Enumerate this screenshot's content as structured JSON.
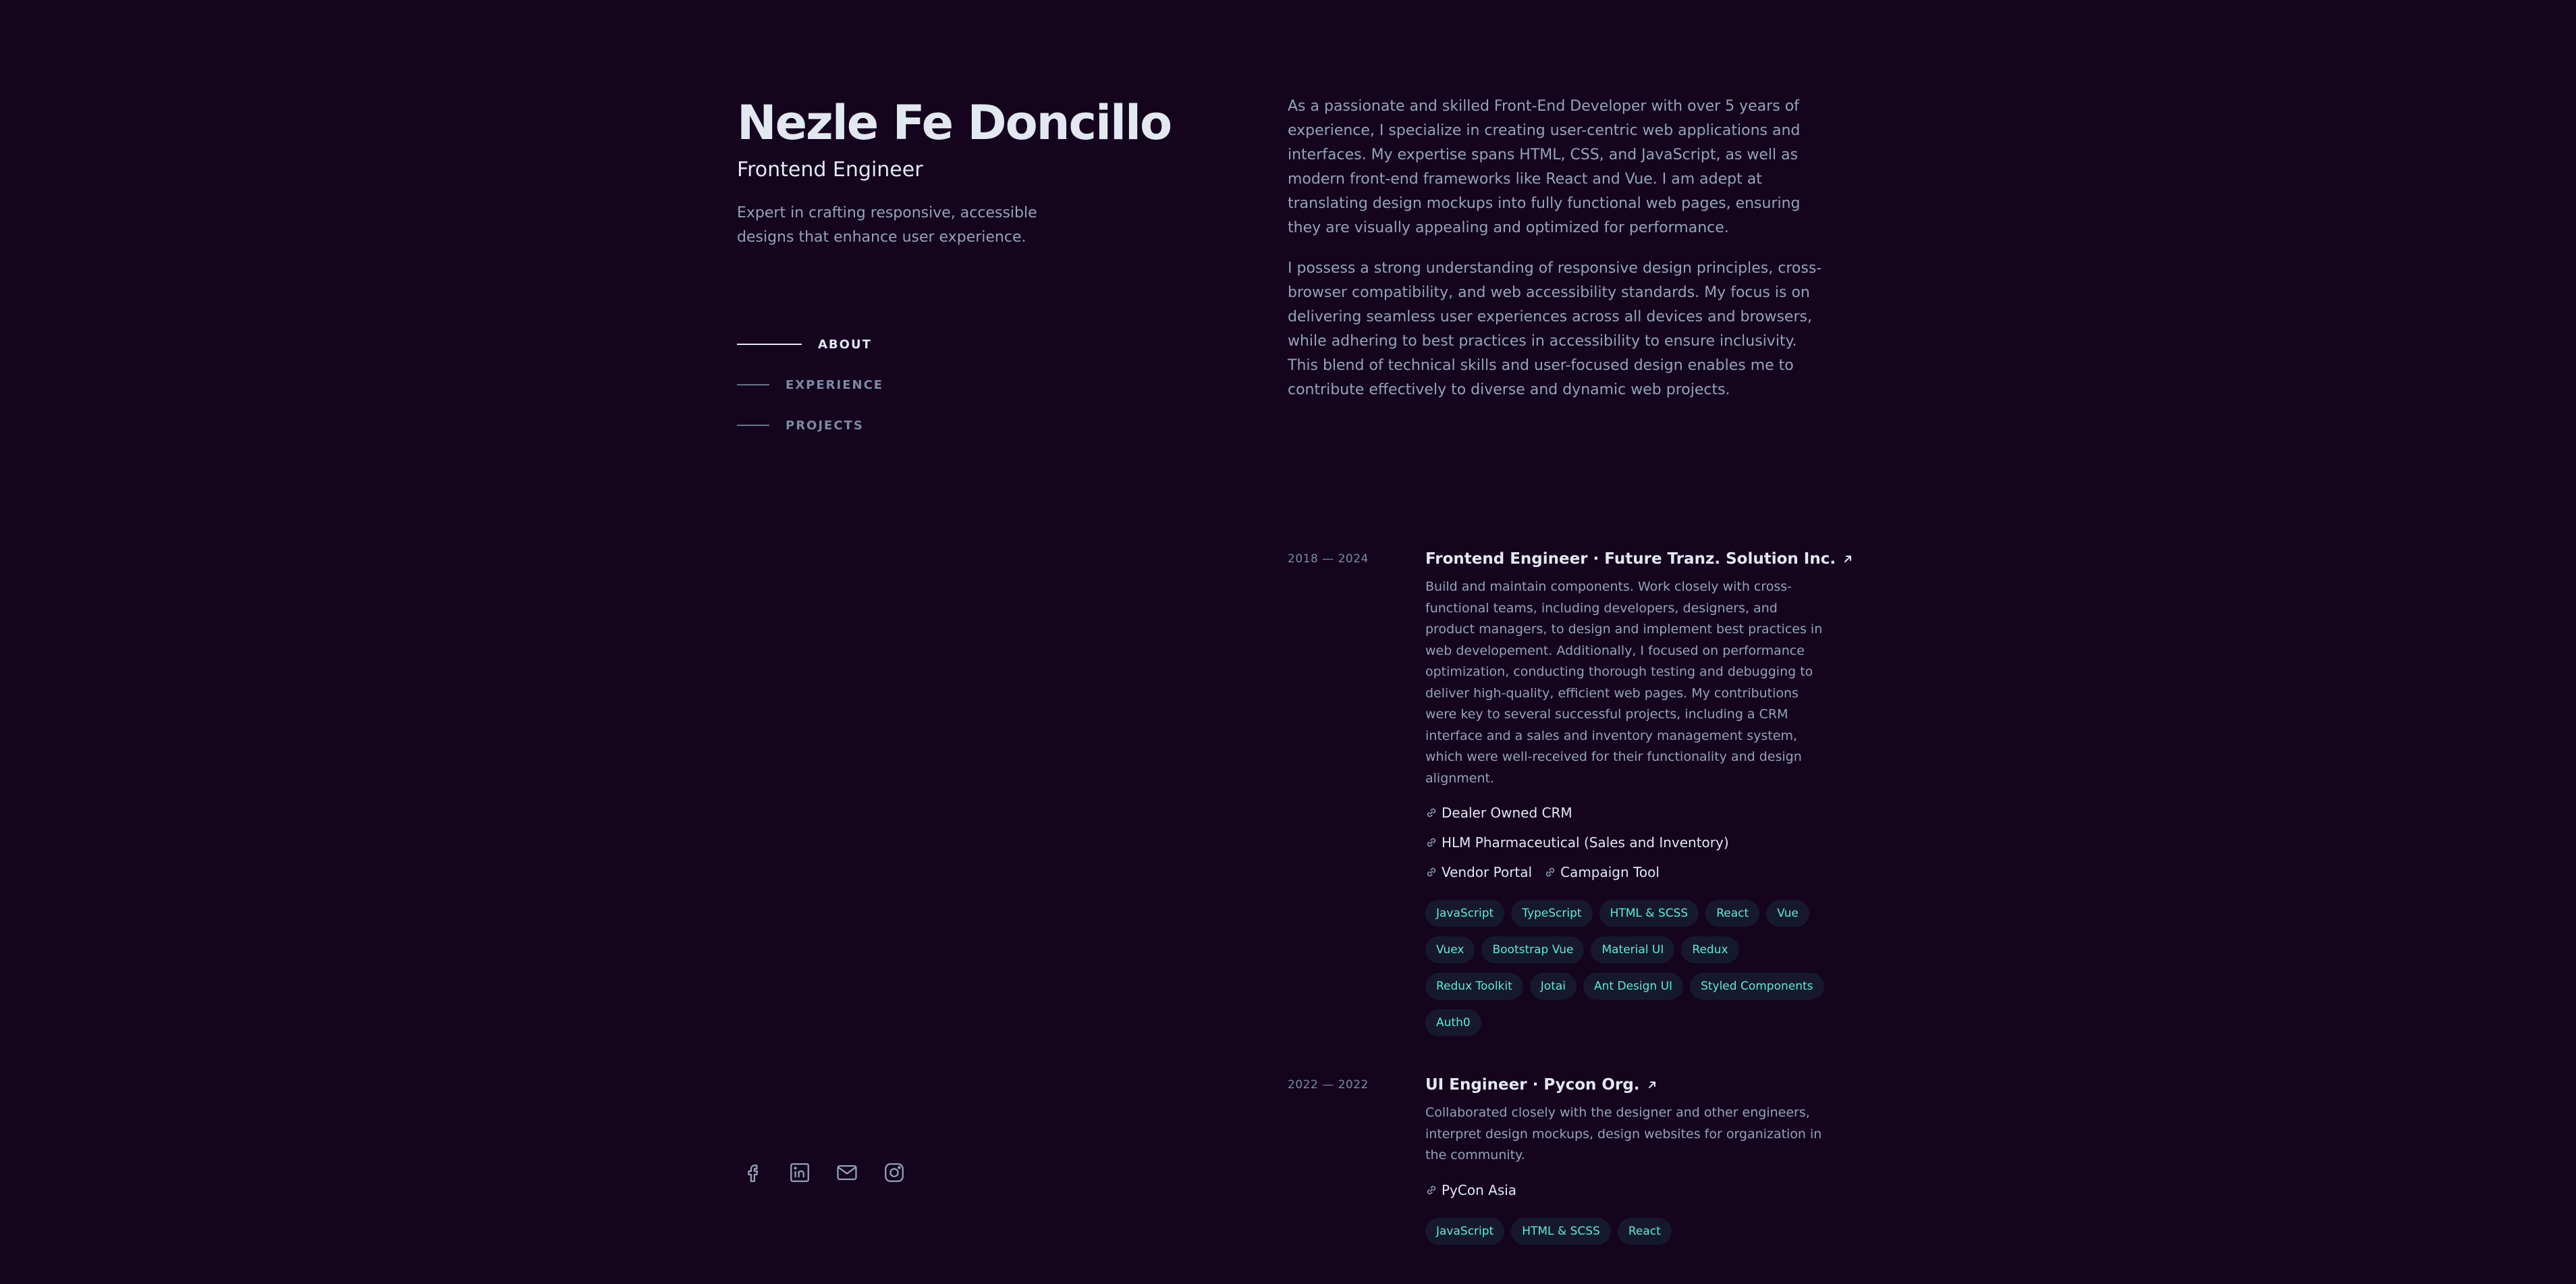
{
  "header": {
    "name": "Nezle Fe Doncillo",
    "role": "Frontend Engineer",
    "tagline": "Expert in crafting responsive, accessible designs that enhance user experience."
  },
  "nav": {
    "items": [
      {
        "label": "ABOUT",
        "active": true
      },
      {
        "label": "EXPERIENCE",
        "active": false
      },
      {
        "label": "PROJECTS",
        "active": false
      }
    ]
  },
  "social": {
    "icons": [
      "facebook-icon",
      "linkedin-icon",
      "mail-icon",
      "instagram-icon"
    ]
  },
  "about": {
    "paragraphs": [
      "As a passionate and skilled Front-End Developer with over 5 years of experience, I specialize in creating user-centric web applications and interfaces. My expertise spans HTML, CSS, and JavaScript, as well as modern front-end frameworks like React and Vue. I am adept at translating design mockups into fully functional web pages, ensuring they are visually appealing and optimized for performance.",
      "I possess a strong understanding of responsive design principles, cross-browser compatibility, and web accessibility standards. My focus is on delivering seamless user experiences across all devices and browsers, while adhering to best practices in accessibility to ensure inclusivity. This blend of technical skills and user-focused design enables me to contribute effectively to diverse and dynamic web projects."
    ]
  },
  "experience": [
    {
      "date": "2018 — 2024",
      "title": "Frontend Engineer · Future Tranz. Solution Inc.",
      "description": "Build and maintain components. Work closely with cross-functional teams, including developers, designers, and product managers, to design and implement best practices in web developement. Additionally, I focused on performance optimization, conducting thorough testing and debugging to deliver high-quality, efficient web pages. My contributions were key to several successful projects, including a CRM interface and a sales and inventory management system, which were well-received for their functionality and design alignment.",
      "links": [
        "Dealer Owned CRM",
        "HLM Pharmaceutical (Sales and Inventory)",
        "Vendor Portal",
        "Campaign Tool"
      ],
      "tags": [
        "JavaScript",
        "TypeScript",
        "HTML & SCSS",
        "React",
        "Vue",
        "Vuex",
        "Bootstrap Vue",
        "Material UI",
        "Redux",
        "Redux Toolkit",
        "Jotai",
        "Ant Design UI",
        "Styled Components",
        "Auth0"
      ]
    },
    {
      "date": "2022 — 2022",
      "title": "UI Engineer · Pycon Org.",
      "description": "Collaborated closely with the designer and other engineers, interpret design mockups, design websites for organization in the community.",
      "links": [
        "PyCon Asia"
      ],
      "tags": [
        "JavaScript",
        "HTML & SCSS",
        "React"
      ]
    }
  ],
  "colors": {
    "background": "#14041e",
    "heading": "#e2e8f0",
    "body_text": "#94a3b8",
    "tag_text": "#5eead4"
  }
}
